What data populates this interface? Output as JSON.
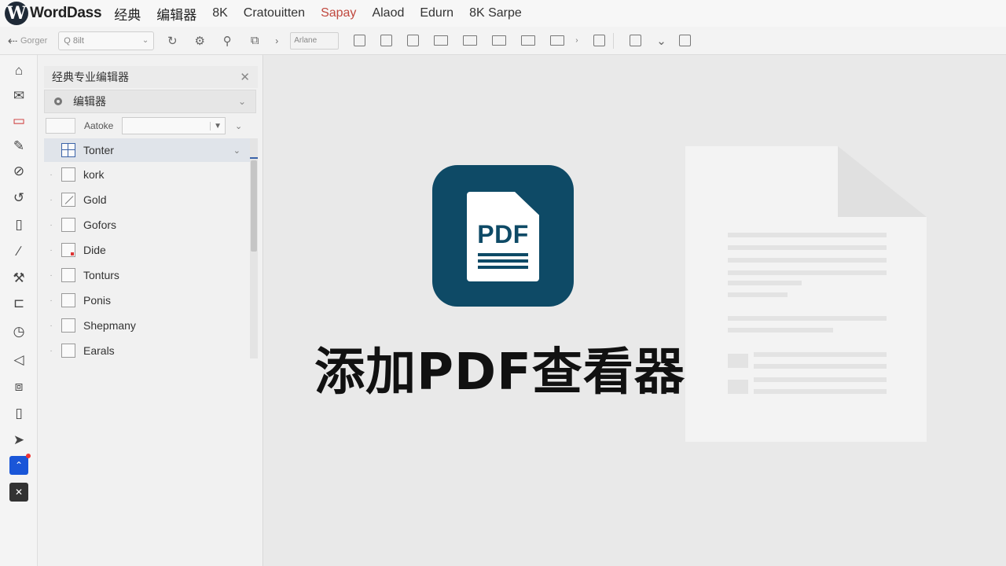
{
  "app": {
    "logo_letter": "W",
    "name": "WordDass",
    "menu": [
      "经典",
      "编辑器",
      "8K",
      "Cratouitten",
      "Sapay",
      "Alaod",
      "Edurn",
      "8K Sarpe"
    ]
  },
  "toolbar": {
    "back_label": "Gorger",
    "search_text": "Q 8ilt",
    "field_text": "Arlane"
  },
  "panel": {
    "title": "经典专业编辑器",
    "select_value": "编辑器",
    "filter_label": "Aatoke",
    "items": [
      {
        "label": "Tonter"
      },
      {
        "label": "kork"
      },
      {
        "label": "Gold"
      },
      {
        "label": "Gofors"
      },
      {
        "label": "Dide"
      },
      {
        "label": "Tonturs"
      },
      {
        "label": "Ponis"
      },
      {
        "label": "Shepmany"
      },
      {
        "label": "Earals"
      }
    ]
  },
  "main": {
    "icon_text": "PDF",
    "headline": "添加PDF查看器"
  },
  "colors": {
    "brand_dark": "#0e4a66",
    "accent_red": "#c0483e",
    "rail_blue": "#1a56d8"
  }
}
